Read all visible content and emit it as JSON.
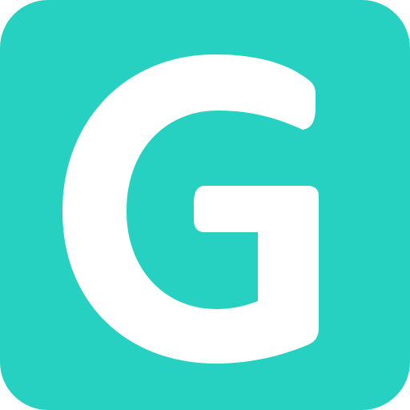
{
  "icon": {
    "name": "letter-g-app-icon",
    "letter": "G",
    "background_color": "#27d1c1",
    "foreground_color": "#ffffff"
  }
}
